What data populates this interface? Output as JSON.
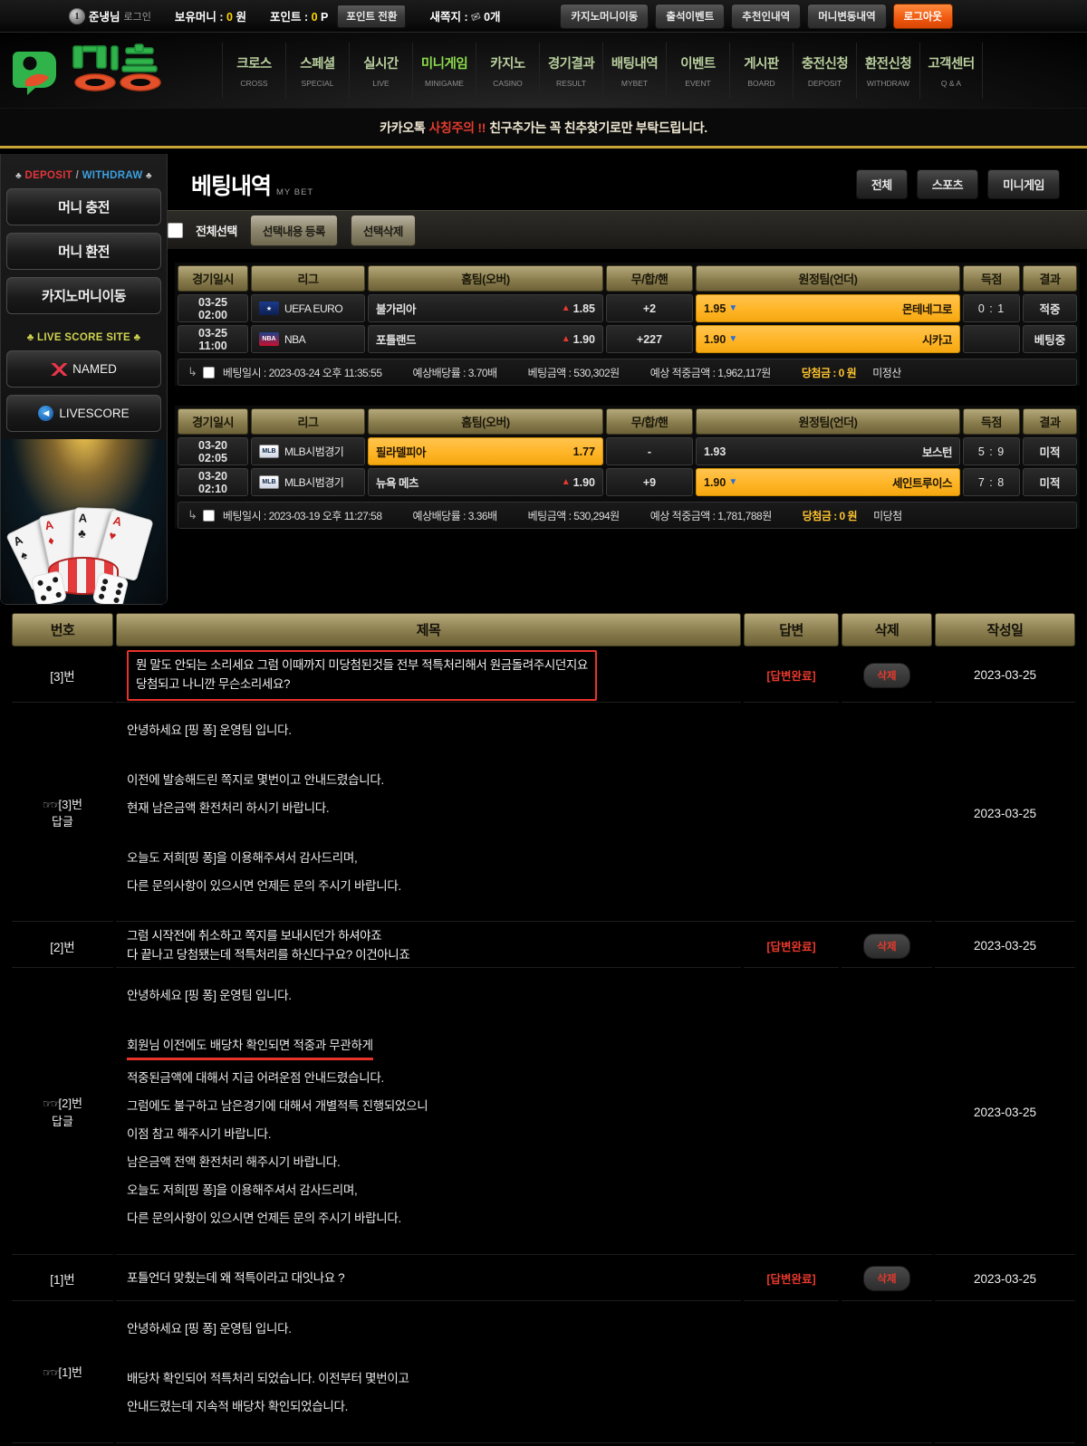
{
  "topbar": {
    "rank": "1",
    "username": "준냉님",
    "login_text": "로그인",
    "money_label": "보유머니 :",
    "money_value": "0",
    "money_unit": "원",
    "point_label": "포인트 :",
    "point_value": "0",
    "point_unit": "P",
    "point_convert_btn": "포인트 전환",
    "note_label": "새쪽지 :",
    "note_count": "0개",
    "buttons": [
      {
        "label": "카지노머니이동",
        "style": "normal"
      },
      {
        "label": "출석이벤트",
        "style": "normal"
      },
      {
        "label": "추천인내역",
        "style": "normal"
      },
      {
        "label": "머니변동내역",
        "style": "normal"
      },
      {
        "label": "로그아웃",
        "style": "logout"
      }
    ]
  },
  "brand": {
    "name": "핑퐁"
  },
  "nav": [
    {
      "ko": "크로스",
      "en": "CROSS",
      "active": false
    },
    {
      "ko": "스페셜",
      "en": "SPECIAL",
      "active": false
    },
    {
      "ko": "실시간",
      "en": "LIVE",
      "active": false
    },
    {
      "ko": "미니게임",
      "en": "MINIGAME",
      "active": true
    },
    {
      "ko": "카지노",
      "en": "CASINO",
      "active": false
    },
    {
      "ko": "경기결과",
      "en": "RESULT",
      "active": false
    },
    {
      "ko": "배팅내역",
      "en": "MYBET",
      "active": false
    },
    {
      "ko": "이벤트",
      "en": "EVENT",
      "active": false
    },
    {
      "ko": "게시판",
      "en": "BOARD",
      "active": false
    },
    {
      "ko": "충전신청",
      "en": "DEPOSIT",
      "active": false
    },
    {
      "ko": "환전신청",
      "en": "WITHDRAW",
      "active": false
    },
    {
      "ko": "고객센터",
      "en": "Q & A",
      "active": false
    }
  ],
  "notice": {
    "pre": "카카오톡 ",
    "warn": "사칭주의 !!",
    "post": " 친구추가는 꼭 친추찾기로만 부탁드립니다."
  },
  "sidebar": {
    "deposit_withdraw_label": {
      "left_sp": "♣",
      "deposit": "DEPOSIT",
      "slash": " / ",
      "withdraw": "WITHDRAW",
      "right_sp": "♣"
    },
    "buttons": [
      {
        "label": "머니 충전"
      },
      {
        "label": "머니 환전"
      },
      {
        "label": "카지노머니이동"
      }
    ],
    "livescore_label": "♣ LIVE SCORE SITE ♣",
    "score_sites": [
      {
        "label": "NAMED",
        "icon": "named-icon"
      },
      {
        "label": "LIVESCORE",
        "icon": "livescore-icon"
      }
    ]
  },
  "mybet": {
    "title": "베팅내역",
    "subtitle": "MY BET",
    "filters": [
      "전체",
      "스포츠",
      "미니게임"
    ],
    "toolbar": {
      "select_all": "전체선택",
      "register_btn": "선택내용 등록",
      "delete_btn": "선택삭제"
    },
    "columns": [
      "경기일시",
      "리그",
      "홈팀(오버)",
      "무/합/핸",
      "원정팀(언더)",
      "득점",
      "결과"
    ],
    "slips": [
      {
        "rows": [
          {
            "date": "03-25  02:00",
            "league": "UEFA EURO",
            "league_code": "uefa",
            "home_name": "불가리아",
            "home_odds": "1.85",
            "home_trend": "up",
            "home_selected": false,
            "handicap": "+2",
            "away_name": "몬테네그로",
            "away_odds": "1.95",
            "away_trend": "down",
            "away_selected": true,
            "score": "0 : 1",
            "result": "적중",
            "result_type": "win"
          },
          {
            "date": "03-25  11:00",
            "league": "NBA",
            "league_code": "nba",
            "home_name": "포틀랜드",
            "home_odds": "1.90",
            "home_trend": "up",
            "home_selected": false,
            "handicap": "+227",
            "away_name": "시카고",
            "away_odds": "1.90",
            "away_trend": "down",
            "away_selected": true,
            "score": "",
            "result": "베팅중",
            "result_type": "pend"
          }
        ],
        "summary": {
          "bet_time": "베팅일시 : 2023-03-24 오후 11:35:55",
          "odds": "예상배당률 : 3.70배",
          "amount": "베팅금액 : 530,302원",
          "expected": "예상 적중금액 : 1,962,117원",
          "winning": "당첨금 : 0 원",
          "status": "미정산"
        }
      },
      {
        "rows": [
          {
            "date": "03-20  02:05",
            "league": "MLB시범경기",
            "league_code": "mlb",
            "home_name": "필라델피아",
            "home_odds": "1.77",
            "home_trend": "none",
            "home_selected": true,
            "handicap": "-",
            "away_name": "보스턴",
            "away_odds": "1.93",
            "away_trend": "none",
            "away_selected": false,
            "score": "5 : 9",
            "result": "미적",
            "result_type": "lose"
          },
          {
            "date": "03-20  02:10",
            "league": "MLB시범경기",
            "league_code": "mlb",
            "home_name": "뉴욕 메츠",
            "home_odds": "1.90",
            "home_trend": "up",
            "home_selected": false,
            "handicap": "+9",
            "away_name": "세인트루이스",
            "away_odds": "1.90",
            "away_trend": "down",
            "away_selected": true,
            "score": "7 : 8",
            "result": "미적",
            "result_type": "lose"
          }
        ],
        "summary": {
          "bet_time": "베팅일시 : 2023-03-19 오후 11:27:58",
          "odds": "예상배당률 : 3.36배",
          "amount": "베팅금액 : 530,294원",
          "expected": "예상 적중금액 : 1,781,788원",
          "winning": "당첨금 : 0 원",
          "status": "미당첨"
        }
      }
    ]
  },
  "board": {
    "columns": [
      "번호",
      "제목",
      "답변",
      "삭제",
      "작성일"
    ],
    "answer_label": "[답변완료]",
    "delete_label": "삭제",
    "posts": [
      {
        "no": "[3]번",
        "title_lines": [
          "뭔 말도 안되는 소리세요 그럼 이때까지 미당첨된것들 전부 적특처리해서 원금돌려주시던지요",
          "당첨되고 나니깐 무슨소리세요?"
        ],
        "highlighted": true,
        "date": "2023-03-25",
        "reply_no": "[3]번",
        "reply_sub": "답글",
        "reply_lines": [
          {
            "text": "안녕하세요 [핑 퐁] 운영팀 입니다.",
            "gap": true,
            "underline": false
          },
          {
            "text": "이전에 발송해드린 쪽지로 몇번이고 안내드렸습니다.",
            "gap": false,
            "underline": false
          },
          {
            "text": "현재 남은금액 환전처리 하시기 바랍니다.",
            "gap": true,
            "underline": false
          },
          {
            "text": "오늘도 저희[핑 퐁]을 이용해주셔서 감사드리며,",
            "gap": false,
            "underline": false
          },
          {
            "text": "다른 문의사항이 있으시면 언제든 문의 주시기 바랍니다.",
            "gap": false,
            "underline": false
          }
        ]
      },
      {
        "no": "[2]번",
        "title_lines": [
          "그럼 시작전에 취소하고 쪽지를 보내시던가 하셔야죠",
          "다 끝나고 당첨됐는데 적특처리를 하신다구요? 이건아니죠"
        ],
        "highlighted": false,
        "date": "2023-03-25",
        "reply_no": "[2]번",
        "reply_sub": "답글",
        "reply_lines": [
          {
            "text": "안녕하세요 [핑 퐁] 운영팀 입니다.",
            "gap": true,
            "underline": false
          },
          {
            "text": "회원님 이전에도 배당차 확인되면 적중과 무관하게",
            "gap": false,
            "underline": true
          },
          {
            "text": "적중된금액에 대해서 지급 어려운점 안내드렸습니다.",
            "gap": false,
            "underline": false
          },
          {
            "text": "그럼에도 불구하고 남은경기에 대해서 개별적특 진행되었으니",
            "gap": false,
            "underline": false
          },
          {
            "text": "이점 참고 해주시기 바랍니다.",
            "gap": false,
            "underline": false
          },
          {
            "text": "남은금액 전액 환전처리 해주시기 바랍니다.",
            "gap": false,
            "underline": false
          },
          {
            "text": "오늘도 저희[핑 퐁]을 이용해주셔서 감사드리며,",
            "gap": false,
            "underline": false
          },
          {
            "text": "다른 문의사항이 있으시면 언제든 문의 주시기 바랍니다.",
            "gap": false,
            "underline": false
          }
        ]
      },
      {
        "no": "[1]번",
        "title_lines": [
          "포틀언더 맞췄는데 왜 적특이라고 대잇나요 ?"
        ],
        "highlighted": false,
        "date": "2023-03-25",
        "reply_no": "[1]번",
        "reply_sub": "답글",
        "reply_lines": [
          {
            "text": "안녕하세요 [핑 퐁] 운영팀 입니다.",
            "gap": true,
            "underline": false
          },
          {
            "text": "배당차 확인되어 적특처리 되었습니다. 이전부터 몇번이고",
            "gap": false,
            "underline": false
          },
          {
            "text": "안내드렸는데 지속적 배당차 확인되었습니다.",
            "gap": false,
            "underline": false
          }
        ]
      }
    ]
  }
}
